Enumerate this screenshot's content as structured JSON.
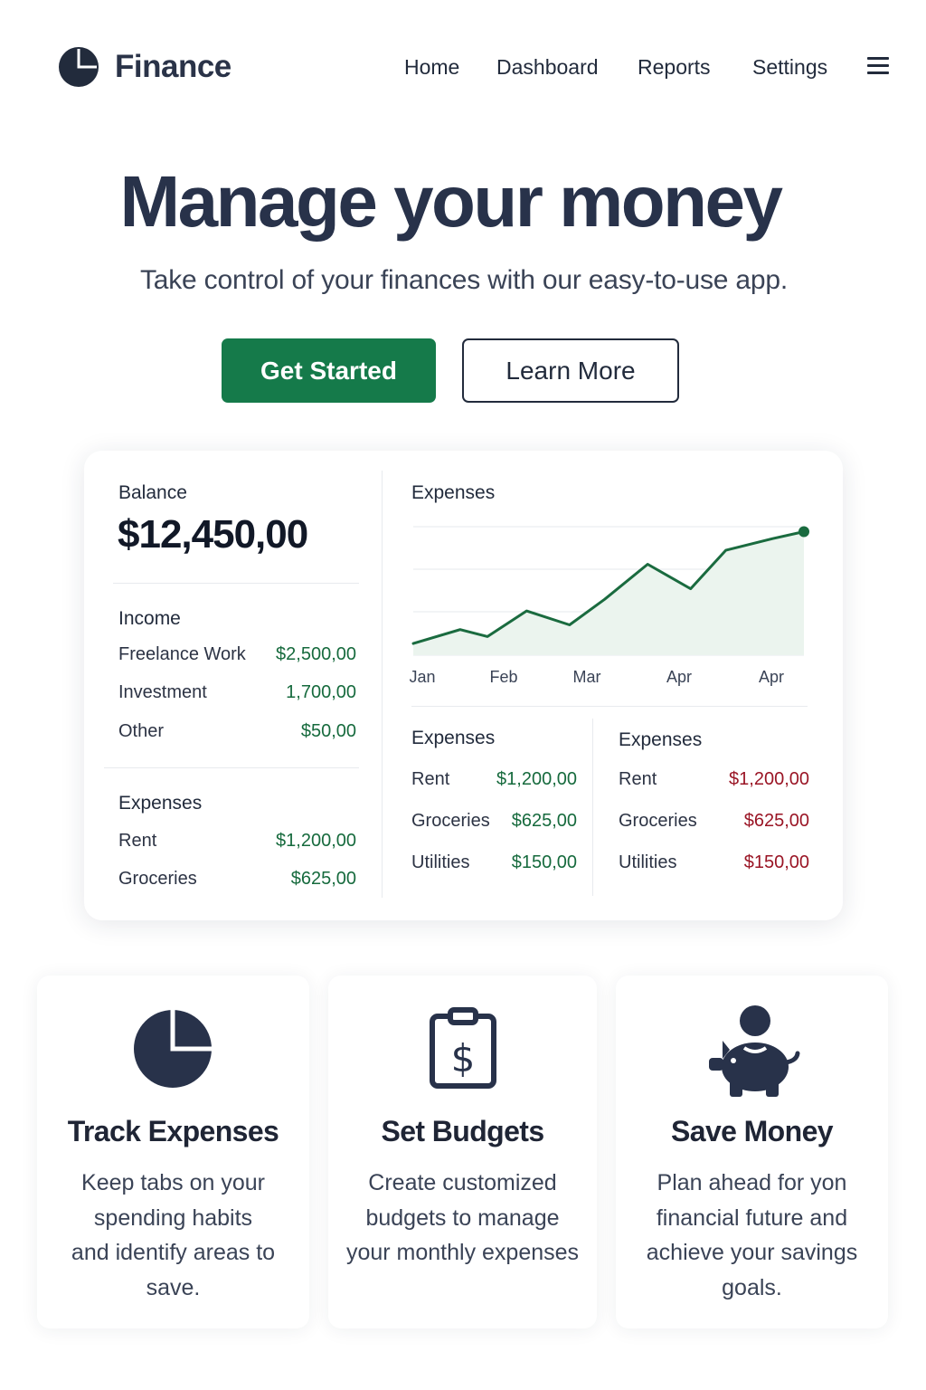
{
  "brand": "Finance",
  "nav": [
    "Home",
    "Dashboard",
    "Reports",
    "Settings"
  ],
  "hero": {
    "title": "Manage your money",
    "subtitle": "Take control of your finances with our easy-to-use app.",
    "primary_button": "Get Started",
    "secondary_button": "Learn More"
  },
  "dashboard": {
    "balance_label": "Balance",
    "balance_value": "$12,450,00",
    "income_heading": "Income",
    "income": [
      {
        "name": "Freelance Work",
        "amount": "$2,500,00"
      },
      {
        "name": "Investment",
        "amount": "1,700,00"
      },
      {
        "name": "Other",
        "amount": "$50,00"
      }
    ],
    "expenses_heading": "Expenses",
    "expenses": [
      {
        "name": "Rent",
        "amount": "$1,200,00"
      },
      {
        "name": "Groceries",
        "amount": "$625,00"
      }
    ],
    "chart_title": "Expenses",
    "table_mid": {
      "heading": "Expenses",
      "rows": [
        {
          "name": "Rent",
          "amount": "$1,200,00"
        },
        {
          "name": "Groceries",
          "amount": "$625,00"
        },
        {
          "name": "Utilities",
          "amount": "$150,00"
        }
      ]
    },
    "table_right": {
      "heading": "Expenses",
      "rows": [
        {
          "name": "Rent",
          "amount": "$1,200,00"
        },
        {
          "name": "Groceries",
          "amount": "$625,00"
        },
        {
          "name": "Utilities",
          "amount": "$150,00"
        }
      ]
    }
  },
  "chart_data": {
    "type": "area",
    "title": "Expenses",
    "categories": [
      "Jan",
      "Feb",
      "Mar",
      "Apr",
      "Apr"
    ],
    "x": [
      0,
      0.6,
      0.95,
      1.45,
      2.0,
      2.45,
      3.0,
      3.55,
      4.0,
      4.6,
      5.0
    ],
    "values": [
      0.5,
      1.1,
      0.8,
      1.9,
      1.3,
      2.4,
      3.9,
      2.85,
      4.5,
      5.0,
      5.3
    ],
    "grid": true,
    "line_color": "#1a6b3f",
    "fill_color": "#ebf4ee"
  },
  "features": [
    {
      "icon": "pie-chart-icon",
      "title": "Track Expenses",
      "lines": [
        "Keep tabs on your",
        "spending habits",
        "and identify areas to",
        "save."
      ]
    },
    {
      "icon": "clipboard-dollar-icon",
      "title": "Set Budgets",
      "lines": [
        "Create customized",
        "budgets to manage",
        "your monthly expenses"
      ]
    },
    {
      "icon": "piggy-bank-icon",
      "title": "Save Money",
      "lines": [
        "Plan ahead for yon",
        "financial future and",
        "achieve your savings",
        "goals."
      ]
    }
  ],
  "colors": {
    "primary": "#157a4a",
    "text_dark": "#222b3c",
    "income_green": "#166a3d",
    "expense_red": "#9a1525"
  }
}
